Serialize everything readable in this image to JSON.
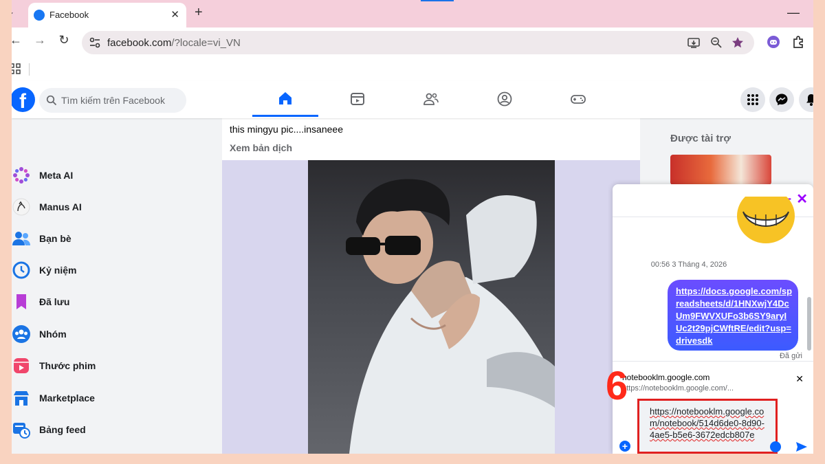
{
  "browser": {
    "tab_title": "Facebook",
    "url_domain": "facebook.com",
    "url_path": "/?locale=vi_VN"
  },
  "facebook": {
    "search_placeholder": "Tìm kiếm trên Facebook",
    "sidebar": [
      {
        "label": "Meta AI",
        "icon": "meta-ai-icon"
      },
      {
        "label": "Manus AI",
        "icon": "manus-ai-icon"
      },
      {
        "label": "Bạn bè",
        "icon": "friends-icon"
      },
      {
        "label": "Kỷ niệm",
        "icon": "memories-icon"
      },
      {
        "label": "Đã lưu",
        "icon": "saved-icon"
      },
      {
        "label": "Nhóm",
        "icon": "groups-icon"
      },
      {
        "label": "Thước phim",
        "icon": "reels-icon"
      },
      {
        "label": "Marketplace",
        "icon": "marketplace-icon"
      },
      {
        "label": "Bảng feed",
        "icon": "feeds-icon"
      }
    ],
    "post": {
      "text": "this mingyu pic....insaneee",
      "translate_label": "Xem bản dịch"
    },
    "right": {
      "sponsored_label": "Được tài trợ"
    }
  },
  "chat": {
    "timestamp": "00:56 3 Tháng 4, 2026",
    "sent_message_link": "https://docs.google.com/spreadsheets/d/1HNXwjY4DcUm9FWVXUFo3b6SY9aryIUc2t29pjCWftRE/edit?usp=drivesdk",
    "sent_status": "Đã gửi",
    "link_preview_domain": "notebooklm.google.com",
    "link_preview_url": "https://notebooklm.google.com/...",
    "composer_text": "https://notebooklm.google.com/notebook/514d6de0-8d90-4ae5-b5e6-3672edcb807e"
  },
  "annotation": {
    "step_number": "6",
    "highlight_color": "#e02020"
  },
  "colors": {
    "fb_blue": "#0866ff",
    "tab_strip": "#f5cfdb",
    "page_border": "#f9d3c0"
  }
}
